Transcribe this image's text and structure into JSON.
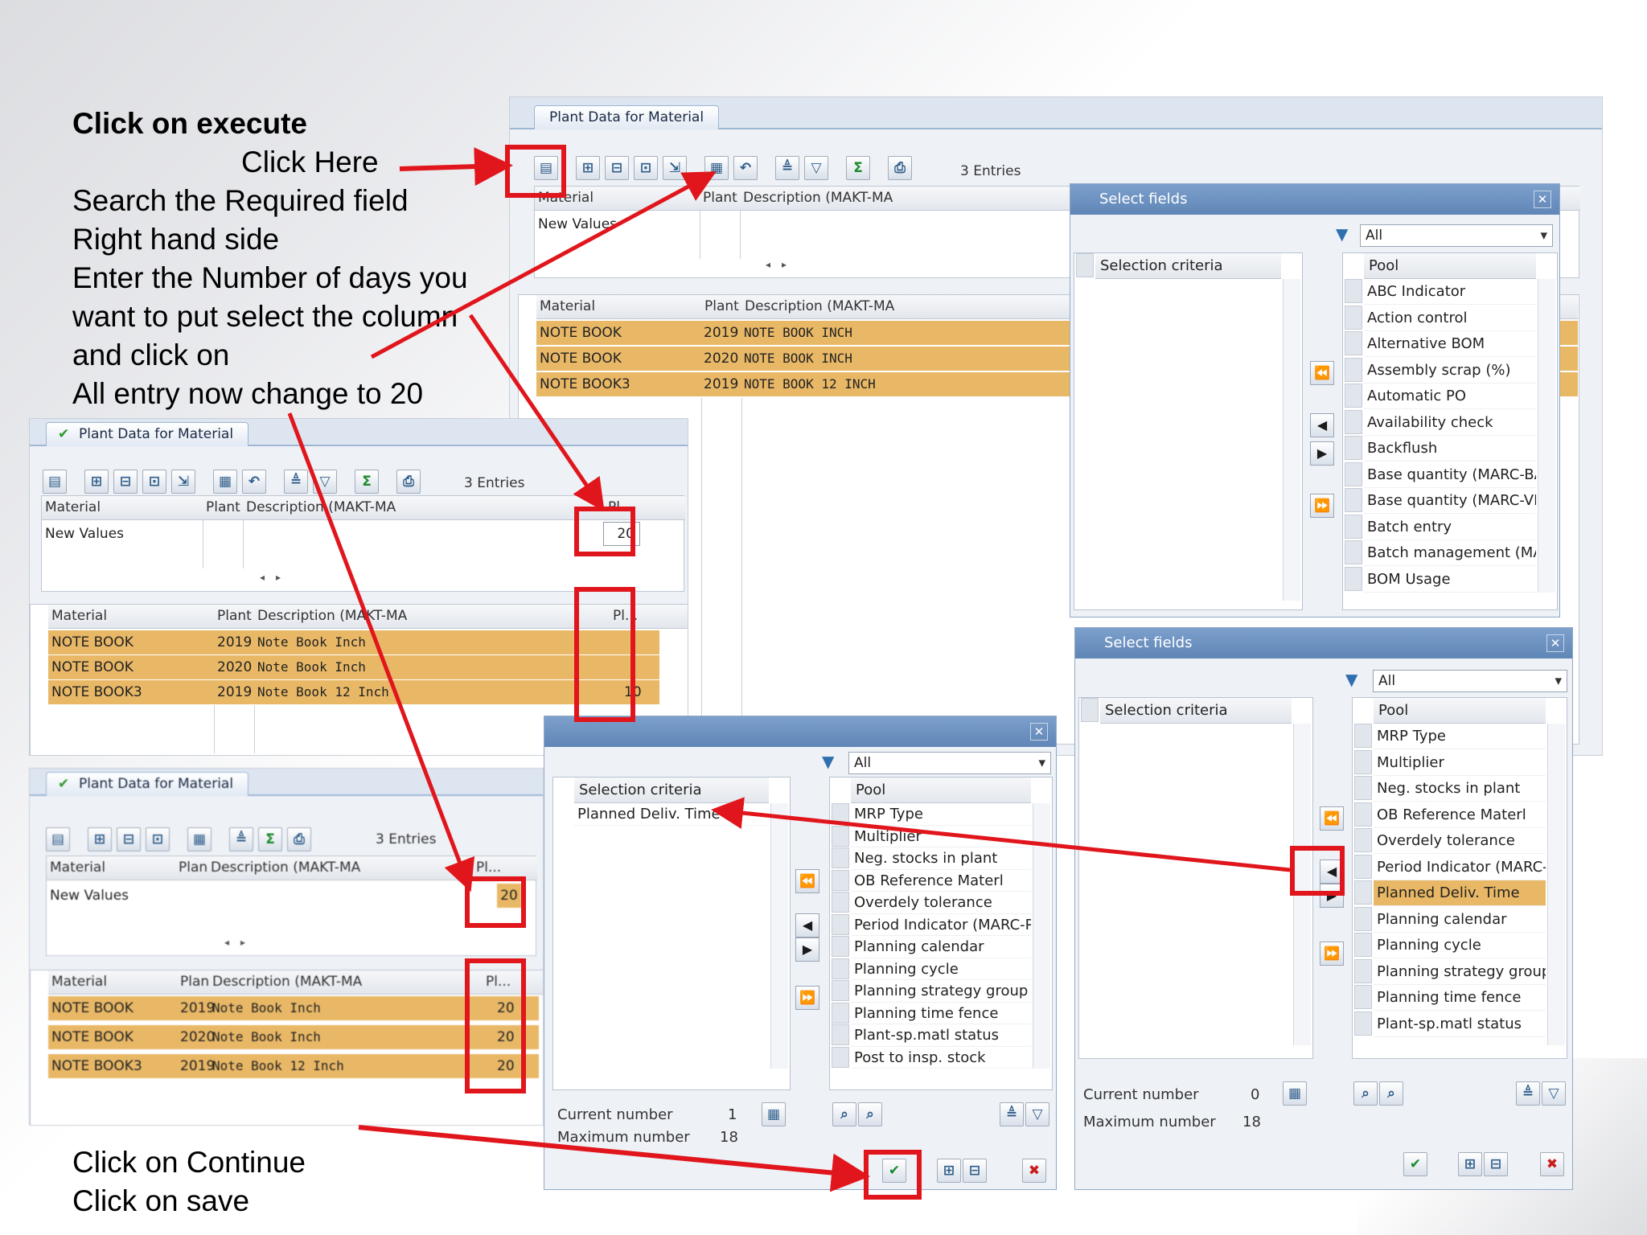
{
  "annotations": {
    "click_execute": "Click on execute",
    "click_here": "Click Here",
    "line1": "Search the Required field",
    "line2": "Right hand side",
    "line3": "Enter the Number of days you",
    "line4": "want to put select the column",
    "line5": "and click on",
    "line6": "All entry now change to 20",
    "continue": "Click on Continue",
    "save": "Click on save"
  },
  "main_panel": {
    "tab": "Plant Data for Material",
    "entries": "3 Entries",
    "top_headers": [
      "Material",
      "Plant",
      "Description (MAKT-MA"
    ],
    "new_values": "New Values",
    "bottom_headers": [
      "Material",
      "Plant",
      "Description (MAKT-MA"
    ],
    "rows": [
      {
        "material": "NOTE BOOK",
        "plant": "2019",
        "desc": "NOTE BOOK INCH"
      },
      {
        "material": "NOTE BOOK",
        "plant": "2020",
        "desc": "NOTE BOOK INCH"
      },
      {
        "material": "NOTE BOOK3",
        "plant": "2019",
        "desc": "NOTE BOOK 12 INCH"
      }
    ]
  },
  "mid_panel": {
    "tab": "Plant Data for Material",
    "entries": "3 Entries",
    "top_headers": [
      "Material",
      "Plant",
      "Description (MAKT-MA",
      "Pl..."
    ],
    "new_values": "New Values",
    "new_value": "20",
    "bottom_headers": [
      "Material",
      "Plant",
      "Description (MAKT-MA",
      "Pl..."
    ],
    "rows": [
      {
        "material": "NOTE BOOK",
        "plant": "2019",
        "desc": "Note Book Inch",
        "val": ""
      },
      {
        "material": "NOTE BOOK",
        "plant": "2020",
        "desc": "Note Book Inch",
        "val": ""
      },
      {
        "material": "NOTE BOOK3",
        "plant": "2019",
        "desc": "Note Book 12 Inch",
        "val": "10"
      }
    ]
  },
  "low_panel": {
    "tab": "Plant Data for Material",
    "entries": "3 Entries",
    "top_headers": [
      "Material",
      "Plant",
      "Description (MAKT-MA",
      "Pl..."
    ],
    "new_values": "New Values",
    "new_value": "20",
    "bottom_headers": [
      "Material",
      "Plant",
      "Description (MAKT-MA",
      "Pl..."
    ],
    "rows": [
      {
        "material": "NOTE BOOK",
        "plant": "2019",
        "desc": "Note Book Inch",
        "val": "20"
      },
      {
        "material": "NOTE BOOK",
        "plant": "2020",
        "desc": "Note Book Inch",
        "val": "20"
      },
      {
        "material": "NOTE BOOK3",
        "plant": "2019",
        "desc": "Note Book 12 Inch",
        "val": "20"
      }
    ]
  },
  "dialog_top": {
    "title": "Select fields",
    "filter": "All",
    "selection_header": "Selection criteria",
    "pool_header": "Pool",
    "pool_items": [
      "ABC Indicator",
      "Action control",
      "Alternative BOM",
      "Assembly scrap (%)",
      "Automatic PO",
      "Availability check",
      "Backflush",
      "Base quantity (MARC-BA",
      "Base quantity (MARC-VB",
      "Batch entry",
      "Batch management (MA",
      "BOM Usage"
    ]
  },
  "dialog_right": {
    "title": "Select fields",
    "filter": "All",
    "selection_header": "Selection criteria",
    "pool_header": "Pool",
    "pool_items": [
      "MRP Type",
      "Multiplier",
      "Neg. stocks in plant",
      "OB Reference Materl",
      "Overdely tolerance",
      "Period Indicator (MARC-P",
      "Planned Deliv. Time",
      "Planning calendar",
      "Planning cycle",
      "Planning strategy group",
      "Planning time fence",
      "Plant-sp.matl status"
    ],
    "highlight_index": 6,
    "current_label": "Current number",
    "current_value": "0",
    "max_label": "Maximum number",
    "max_value": "18"
  },
  "dialog_mid": {
    "filter": "All",
    "selection_header": "Selection criteria",
    "selection_items": [
      "Planned Deliv. Time"
    ],
    "pool_header": "Pool",
    "pool_items": [
      "MRP Type",
      "Multiplier",
      "Neg. stocks in plant",
      "OB Reference Materl",
      "Overdely tolerance",
      "Period Indicator (MARC-P",
      "Planning calendar",
      "Planning cycle",
      "Planning strategy group",
      "Planning time fence",
      "Plant-sp.matl status",
      "Post to insp. stock"
    ],
    "current_label": "Current number",
    "current_value": "1",
    "max_label": "Maximum number",
    "max_value": "18"
  },
  "colors": {
    "highlight": "#e9b866",
    "callout": "#e0161c",
    "accent": "#5f86b7"
  },
  "icons": [
    "execute-icon",
    "continue-check-icon",
    "cancel-x-icon",
    "move-left-icon",
    "move-right-icon",
    "move-all-left-icon",
    "move-all-right-icon",
    "filter-icon"
  ]
}
